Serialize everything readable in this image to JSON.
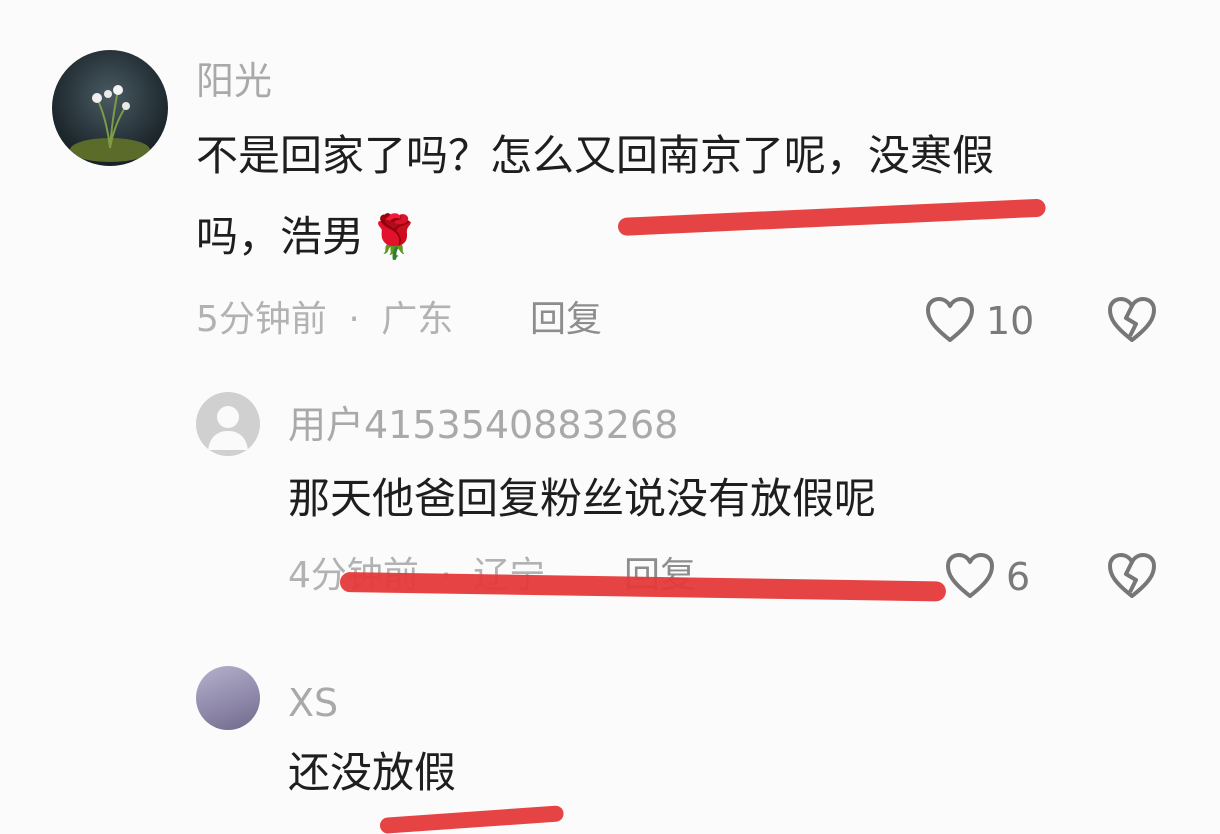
{
  "comments": [
    {
      "username": "阳光",
      "text_line1": "不是回家了吗？怎么又回南京了呢，没寒假",
      "text_line2": "吗，浩男",
      "emoji": "🌹",
      "time": "5分钟前",
      "location": "广东",
      "reply_label": "回复",
      "likes": "10"
    },
    {
      "username": "用户4153540883268",
      "text": "那天他爸回复粉丝说没有放假呢",
      "time": "4分钟前",
      "location": "辽宁",
      "reply_label": "回复",
      "likes": "6"
    },
    {
      "username": "XS",
      "text": "还没放假"
    }
  ],
  "separator": "·",
  "colors": {
    "annotation_red": "#e53a3a",
    "muted_text": "#a9a9a9",
    "body_text": "#1e1e1e"
  },
  "icons": [
    "heart-outline-icon",
    "broken-heart-icon",
    "default-avatar-icon"
  ]
}
